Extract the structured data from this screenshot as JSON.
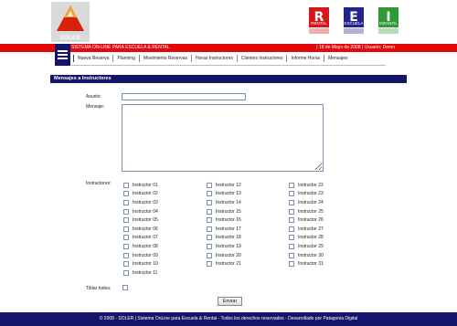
{
  "header": {
    "logo_text": "SOLER",
    "modules": [
      {
        "letter": "R",
        "label": "RENTAL",
        "color": "#d5161c"
      },
      {
        "letter": "E",
        "label": "ESCUELA",
        "color": "#23238a"
      },
      {
        "letter": "I",
        "label": "INFANTIL",
        "color": "#2f9a35"
      }
    ]
  },
  "redbar": {
    "system_name": "SISTEMA ON-LINE PARA ESCUELA & RENTAL",
    "date": "18 de Mayo de 2008",
    "user": "Usuario: Demo"
  },
  "nav": {
    "items": [
      "Nueva Reserva",
      "Planning",
      "Movimiento Reservas",
      "Horas Instructores",
      "Clientes Instructores",
      "Informe Horas",
      "Mensajes"
    ]
  },
  "section": {
    "title": "Mensajes a Instructores"
  },
  "form": {
    "asunto_label": "Asunto:",
    "asunto_value": "",
    "mensaje_label": "Mensaje:",
    "mensaje_value": "",
    "instructores_label": "Instructores:",
    "instructor_columns": [
      [
        "Instructor 01",
        "Instructor 02",
        "Instructor 03",
        "Instructor 04",
        "Instructor 05",
        "Instructor 06",
        "Instructor 07",
        "Instructor 08",
        "Instructor 09",
        "Instructor 10",
        "Instructor 11"
      ],
      [
        "Instructor 12",
        "Instructor 13",
        "Instructor 14",
        "Instructor 15",
        "Instructor 16",
        "Instructor 17",
        "Instructor 18",
        "Instructor 19",
        "Instructor 20",
        "Instructor 21"
      ],
      [
        "Instructor 22",
        "Instructor 23",
        "Instructor 24",
        "Instructor 25",
        "Instructor 26",
        "Instructor 27",
        "Instructor 28",
        "Instructor 29",
        "Instructor 30",
        "Instructor 31"
      ]
    ],
    "tildar_label": "Tildar todos:",
    "submit_label": "Enviar"
  },
  "footer": {
    "text": "© 2008 - SOLER | Sistema OnLine para Escuela & Rental - Todos los derechos reservados - Desarrollado por Patagonia Digital"
  }
}
